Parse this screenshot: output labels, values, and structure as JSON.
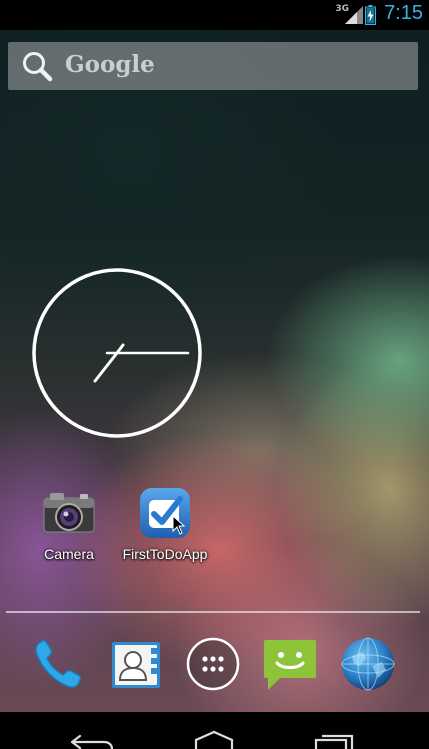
{
  "status_bar": {
    "network_type": "3G",
    "time": "7:15",
    "icons": [
      "signal-icon",
      "battery-charging-icon"
    ]
  },
  "search": {
    "placeholder": "Google",
    "icon": "search-icon"
  },
  "clock_widget": {
    "type": "analog"
  },
  "desktop_apps": [
    {
      "label": "Camera",
      "icon": "camera-icon"
    },
    {
      "label": "FirstToDoApp",
      "icon": "checkmark-icon"
    }
  ],
  "dock": [
    {
      "name": "Phone",
      "icon": "phone-icon"
    },
    {
      "name": "People",
      "icon": "contacts-icon"
    },
    {
      "name": "Apps",
      "icon": "app-drawer-icon"
    },
    {
      "name": "Messaging",
      "icon": "messaging-icon"
    },
    {
      "name": "Browser",
      "icon": "globe-icon"
    }
  ],
  "nav_bar": {
    "buttons": [
      "back-icon",
      "home-icon",
      "recent-apps-icon"
    ]
  },
  "colors": {
    "clock_accent": "#33b5e5",
    "todo_blue": "#2a7bd0"
  }
}
